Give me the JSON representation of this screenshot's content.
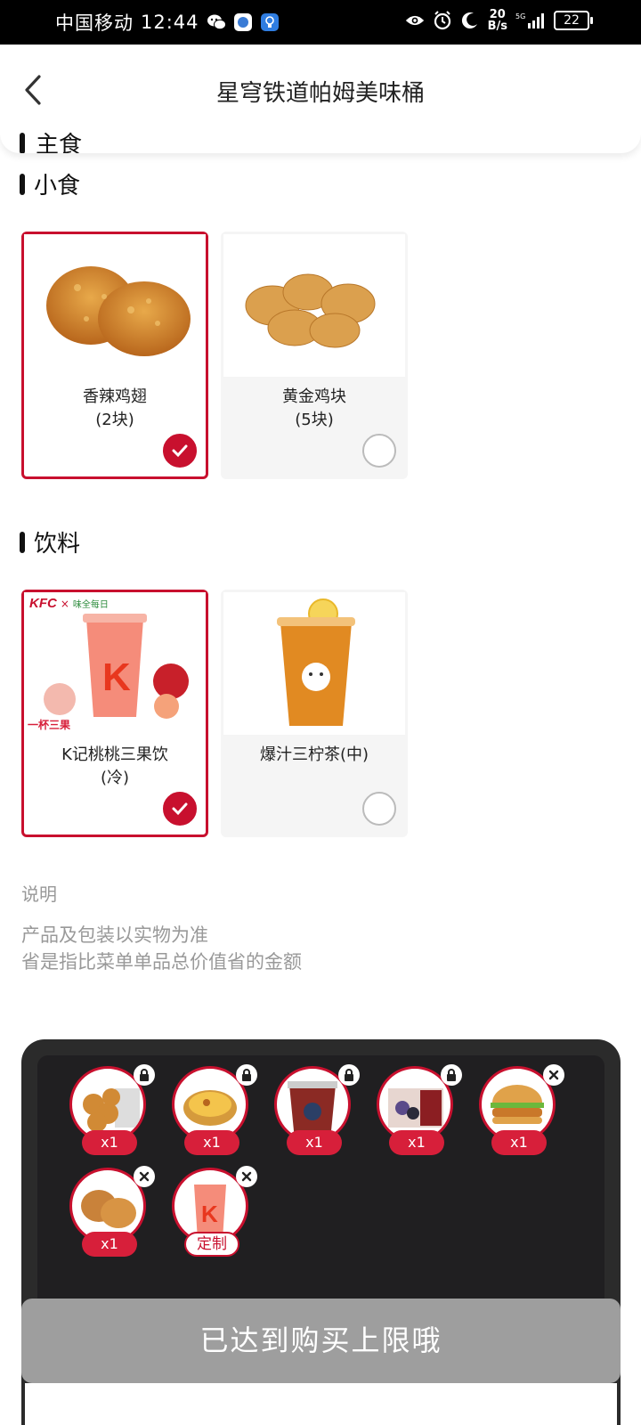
{
  "status_bar": {
    "carrier": "中国移动",
    "time": "12:44",
    "net_speed_value": "20",
    "net_speed_unit": "B/s",
    "signal": "5G",
    "battery": "22"
  },
  "header": {
    "title": "星穹铁道帕姆美味桶",
    "peek_section": "主食"
  },
  "sections": [
    {
      "title": "小食",
      "options": [
        {
          "name": "香辣鸡翅",
          "sub": "(2块)",
          "selected": true
        },
        {
          "name": "黄金鸡块",
          "sub": "(5块)",
          "selected": false
        }
      ]
    },
    {
      "title": "饮料",
      "options": [
        {
          "name": "K记桃桃三果饮",
          "sub": "(冷)",
          "selected": true,
          "brand_left": "KFC",
          "brand_x": "×",
          "brand_right": "味全每日",
          "promo": "一杯三果"
        },
        {
          "name": "爆汁三柠茶(中)",
          "sub": "",
          "selected": false
        }
      ]
    }
  ],
  "notes": {
    "title": "说明",
    "lines": [
      "产品及包装以实物为准",
      "省是指比菜单单品总价值省的金额"
    ]
  },
  "basket": {
    "items": [
      {
        "image": "popcorn-chicken",
        "qty": "x1",
        "badge": "lock"
      },
      {
        "image": "egg-tart",
        "qty": "x1",
        "badge": "lock"
      },
      {
        "image": "collector-bucket",
        "qty": "x1",
        "badge": "lock"
      },
      {
        "image": "character-card",
        "qty": "x1",
        "badge": "lock"
      },
      {
        "image": "burger",
        "qty": "x1",
        "badge": "close"
      },
      {
        "image": "fried-chicken-wings",
        "qty": "x1",
        "badge": "close"
      },
      {
        "image": "peach-drink",
        "qty": "定制",
        "badge": "close"
      }
    ]
  },
  "toast": "已达到购买上限哦",
  "colors": {
    "accent": "#c8102e",
    "panel": "#2b2b2b",
    "toast": "#9e9e9e"
  }
}
